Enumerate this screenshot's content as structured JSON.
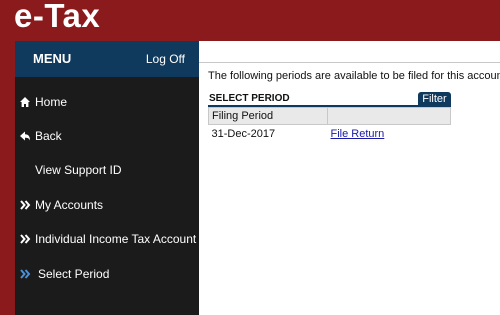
{
  "app": {
    "logo": "e-Tax"
  },
  "colors": {
    "brand_red": "#8a1a1c",
    "menu_blue": "#0f3a5e",
    "sidebar_dark": "#1b1b1b",
    "link": "#1a1aa6"
  },
  "menu": {
    "title": "MENU",
    "logoff": "Log Off"
  },
  "nav": [
    {
      "label": "Home",
      "icon": "home-icon"
    },
    {
      "label": "Back",
      "icon": "back-arrow-icon"
    },
    {
      "label": "View Support ID",
      "icon": ""
    },
    {
      "label": "My Accounts",
      "icon": "double-chevron-icon"
    },
    {
      "label": "Individual Income Tax Account",
      "icon": "double-chevron-icon"
    },
    {
      "label": "Select Period",
      "icon": "double-chevron-icon",
      "active": true
    }
  ],
  "main": {
    "info": "The following periods are available to be filed for this account.",
    "section_label": "SELECT PERIOD",
    "filter_button": "Filter",
    "table": {
      "headers": [
        "Filing Period",
        ""
      ],
      "rows": [
        {
          "period": "31-Dec-2017",
          "action": "File Return"
        }
      ]
    }
  }
}
